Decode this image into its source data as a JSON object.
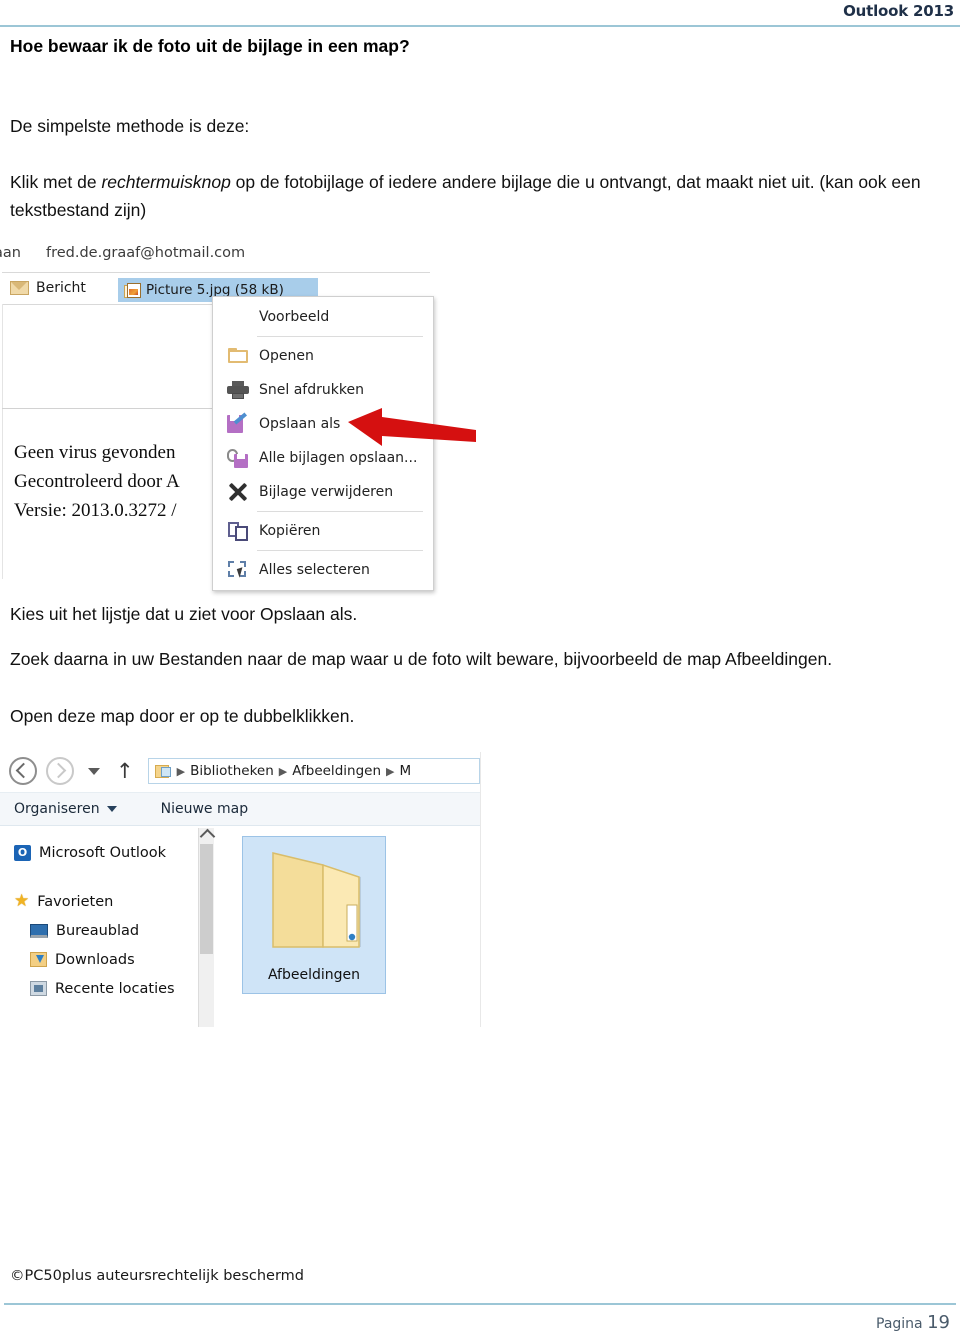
{
  "header": {
    "label": "Outlook 2013",
    "rule_color": "#9cc6d6"
  },
  "document": {
    "title": "Hoe bewaar ik de foto uit de bijlage in een map?",
    "intro": "De simpelste methode is deze:",
    "instruction_prefix": "Klik met de ",
    "instruction_italic": "rechtermuisknop",
    "instruction_suffix": " op de fotobijlage of iedere andere bijlage die u ontvangt, dat maakt niet uit. (kan ook een tekstbestand zijn)",
    "choose_line": "Kies uit het lijstje dat u ziet voor Opslaan als.",
    "search_para": "Zoek daarna in uw Bestanden naar de map waar u de foto wilt beware, bijvoorbeeld de map Afbeeldingen.",
    "open_line": "Open deze map door er op te dubbelklikken."
  },
  "outlook": {
    "to_label": "aan",
    "to_address": "fred.de.graaf@hotmail.com",
    "message_tab": "Bericht",
    "attachment_name": "Picture 5.jpg (58 kB)",
    "virus_lines": [
      "Geen virus gevonden",
      "Gecontroleerd door A",
      "Versie: 2013.0.3272 /"
    ],
    "context_menu": [
      {
        "label": "Voorbeeld",
        "icon": "none",
        "accel": "d"
      },
      {
        "label": "Openen",
        "icon": "open-folder-icon",
        "accel": "O"
      },
      {
        "label": "Snel afdrukken",
        "icon": "printer-icon",
        "accel": "f"
      },
      {
        "label": "Opslaan als",
        "icon": "save-as-icon",
        "accel": "s"
      },
      {
        "label": "Alle bijlagen opslaan...",
        "icon": "save-all-attachments-icon",
        "accel": "A"
      },
      {
        "label": "Bijlage verwijderen",
        "icon": "remove-attachment-icon",
        "accel": "v"
      },
      {
        "label": "Kopiëren",
        "icon": "copy-icon",
        "accel": "K"
      },
      {
        "label": "Alles selecteren",
        "icon": "select-all-icon",
        "accel": "l"
      }
    ],
    "highlight_color": "#a8cdea",
    "arrow_color": "#d51010"
  },
  "explorer": {
    "breadcrumbs": [
      "Bibliotheken",
      "Afbeeldingen",
      "M"
    ],
    "toolbar": {
      "organise": "Organiseren",
      "new_folder": "Nieuwe map"
    },
    "sidebar": [
      {
        "label": "Microsoft Outlook",
        "icon": "outlook-icon",
        "indent": false
      },
      {
        "label": "Favorieten",
        "icon": "star-icon",
        "indent": false
      },
      {
        "label": "Bureaublad",
        "icon": "desktop-icon",
        "indent": true
      },
      {
        "label": "Downloads",
        "icon": "downloads-icon",
        "indent": true
      },
      {
        "label": "Recente locaties",
        "icon": "recent-locations-icon",
        "indent": true
      }
    ],
    "selected_folder": "Afbeeldingen",
    "selection_color": "#cfe4f7"
  },
  "footer": {
    "copyright": "©PC50plus auteursrechtelijk beschermd",
    "page_label": "Pagina",
    "page_number": "19"
  }
}
